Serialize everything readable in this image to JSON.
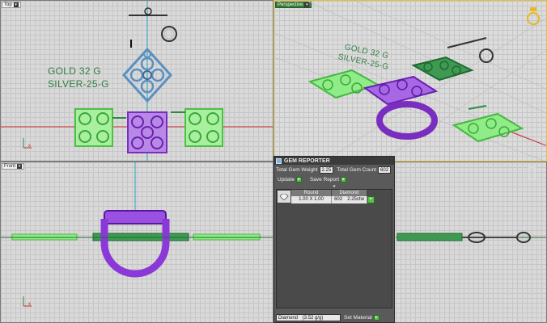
{
  "viewports": {
    "top": {
      "label": "Top"
    },
    "perspective": {
      "label": "Perspective"
    },
    "front": {
      "label": "Front"
    },
    "right": {
      "label": ""
    }
  },
  "annotations": {
    "gold": "GOLD 32 G",
    "silver": "SILVER-25-G",
    "persp_gold": "GOLD 32 G",
    "persp_silver": "SILVER-25-G"
  },
  "colors": {
    "green_gem": "#7fe07a",
    "purple_metal": "#9040d0",
    "blue_gem": "#5a90c0",
    "dark_green": "#2e8a3e",
    "axis_red": "#cc2a2a",
    "axis_cyan": "#2aa8c0"
  },
  "gem_reporter": {
    "title": "GEM REPORTER",
    "total_weight_label": "Total Gem Weight",
    "total_weight_value": "2.25",
    "total_count_label": "Total Gem Count",
    "total_count_value": "602",
    "update_label": "Update",
    "save_report_label": "Save Report",
    "table": {
      "headers": [
        "Round",
        "Diamond"
      ],
      "rows": [
        {
          "size": "1.00 X 1.00",
          "count": "602",
          "weight": "2.25ctw"
        }
      ]
    },
    "material_select": "Diamond",
    "material_density": "(3.52 g/g)",
    "set_material_label": "Set Material"
  },
  "axis_labels": {
    "x": "x",
    "z": "z"
  }
}
